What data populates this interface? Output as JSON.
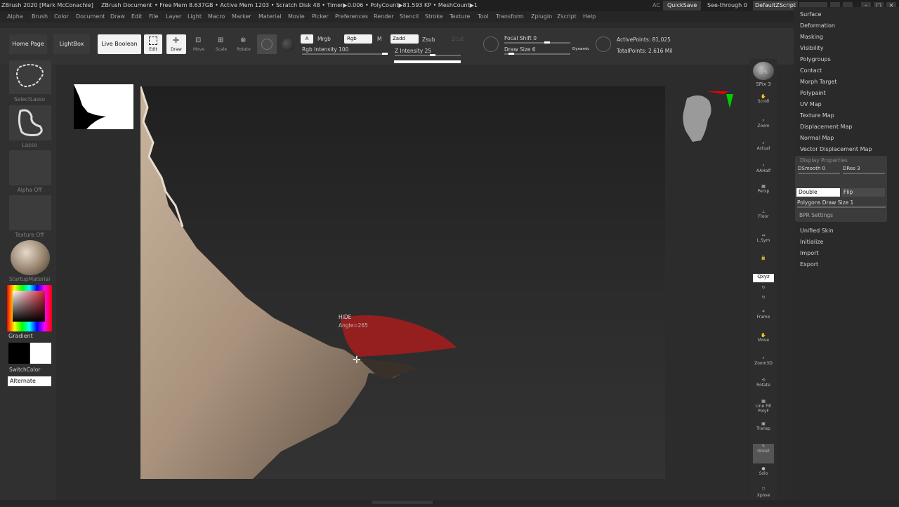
{
  "titlebar": {
    "app": "ZBrush 2020 [Mark McConachie]",
    "doc": "ZBrush Document",
    "stats": "• Free Mem 8.637GB • Active Mem 1203 • Scratch Disk 48 • Timer▶0.006 • PolyCount▶81.593 KP • MeshCount▶1",
    "ac": "AC",
    "quicksave": "QuickSave",
    "seethrough": "See-through 0",
    "script": "DefaultZScript"
  },
  "menu": [
    "Alpha",
    "Brush",
    "Color",
    "Document",
    "Draw",
    "Edit",
    "File",
    "Layer",
    "Light",
    "Macro",
    "Marker",
    "Material",
    "Movie",
    "Picker",
    "Preferences",
    "Render",
    "Stencil",
    "Stroke",
    "Texture",
    "Tool",
    "Transform",
    "Zplugin",
    "Zscript",
    "Help"
  ],
  "toolbar": {
    "home": "Home Page",
    "lightbox": "LightBox",
    "live_boolean": "Live Boolean",
    "edit": "Edit",
    "draw": "Draw",
    "move": "Move",
    "scale": "Scale",
    "rotate": "Rotate",
    "a": "A",
    "mrgb": "Mrgb",
    "rgb": "Rgb",
    "m": "M",
    "zadd": "Zadd",
    "zsub": "Zsub",
    "zcut": "Zcut",
    "rgb_intensity": "Rgb Intensity 100",
    "z_intensity": "Z Intensity 25",
    "focal_shift": "Focal Shift 0",
    "draw_size": "Draw Size 6",
    "dynamic": "Dynamic",
    "active_points": "ActivePoints: 81,025",
    "total_points": "TotalPoints: 2.616 Mil"
  },
  "left": {
    "select_lasso": "SelectLasso",
    "lasso": "Lasso",
    "alpha_off": "Alpha Off",
    "texture_off": "Texture Off",
    "material": "StartupMaterial",
    "gradient": "Gradient",
    "switch_color": "SwitchColor",
    "alternate": "Alternate"
  },
  "canvas": {
    "hide_label": "HIDE",
    "angle_label": "Angle=265"
  },
  "right_shelf": [
    "BPR",
    "SPix 3",
    "Scroll",
    "Zoom",
    "Actual",
    "AAHalf",
    "Persp",
    "Floor",
    "L.Sym",
    "",
    "Qxyz",
    "",
    "",
    "Frame",
    "Move",
    "Zoom3D",
    "Rotate",
    "Line Fill PolyF",
    "Transp",
    "Ghost",
    "Solo",
    "Xpose"
  ],
  "right_panel": {
    "items_top": [
      "Surface",
      "Deformation",
      "Masking",
      "Visibility",
      "Polygroups",
      "Contact",
      "Morph Target",
      "Polypaint",
      "UV Map",
      "Texture Map",
      "Displacement Map",
      "Normal Map",
      "Vector Displacement Map"
    ],
    "display_properties": "Display Properties",
    "dsmooth": "DSmooth 0",
    "dres": "DRes 3",
    "double": "Double",
    "flip": "Flip",
    "polygons_draw_size": "Polygons Draw Size 1",
    "bpr_settings": "BPR Settings",
    "items_bottom": [
      "Unified Skin",
      "Initialize",
      "Import",
      "Export"
    ]
  }
}
